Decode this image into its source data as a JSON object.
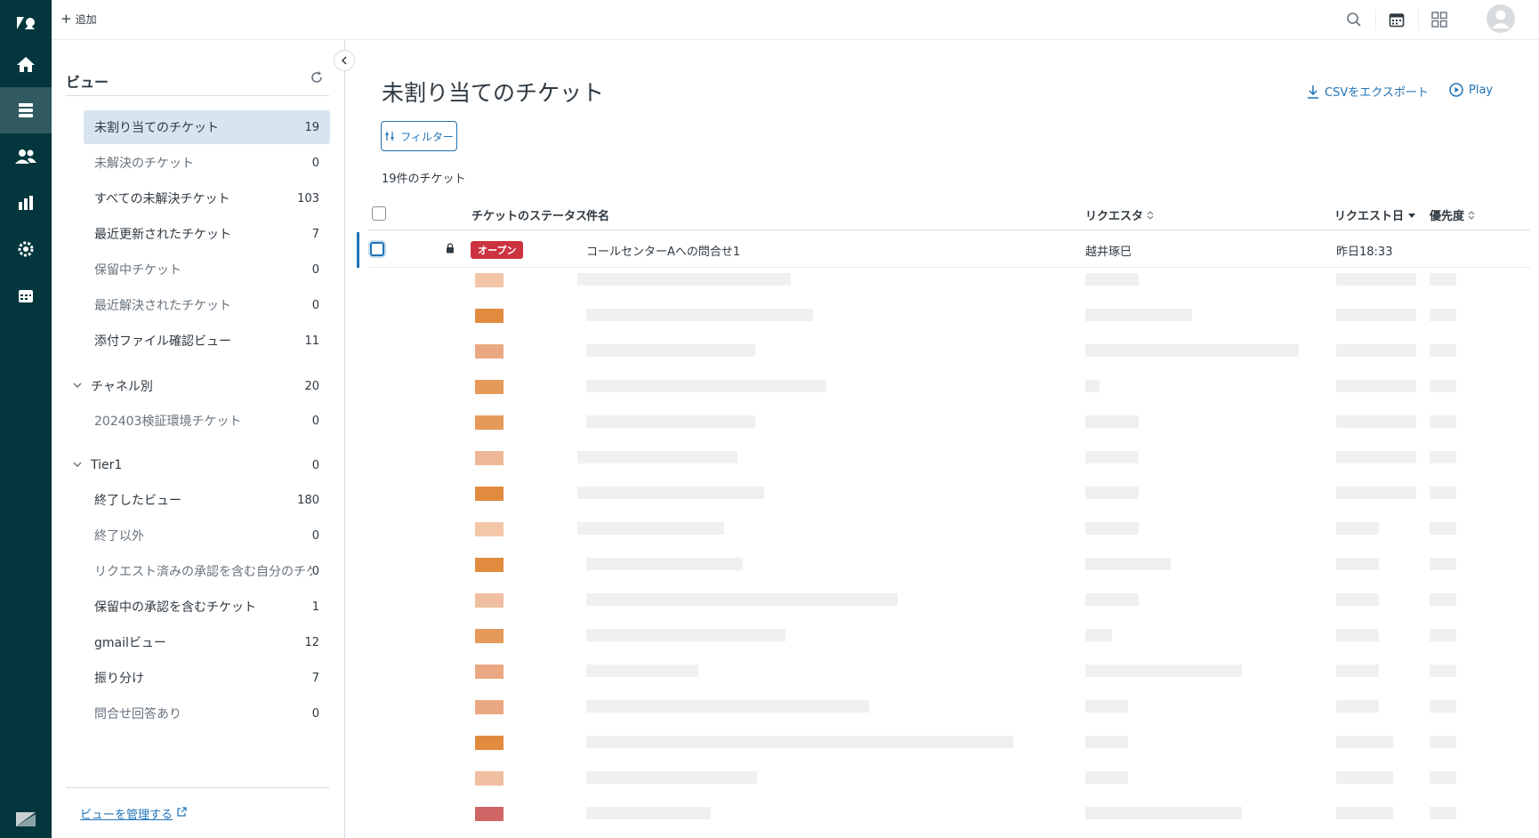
{
  "topbar": {
    "add_label": "追加",
    "icons": [
      "search-icon",
      "calendar-icon",
      "apps-grid-icon",
      "user-avatar-icon"
    ]
  },
  "rail": {
    "items": [
      "home-icon",
      "views-icon",
      "customers-icon",
      "reports-icon",
      "settings-icon",
      "calendar-icon"
    ],
    "active": "views-icon"
  },
  "views": {
    "title": "ビュー",
    "items": [
      {
        "label": "未割り当てのチケット",
        "count": "19"
      },
      {
        "label": "未解決のチケット",
        "count": "0"
      },
      {
        "label": "すべての未解決チケット",
        "count": "103"
      },
      {
        "label": "最近更新されたチケット",
        "count": "7"
      },
      {
        "label": "保留中チケット",
        "count": "0"
      },
      {
        "label": "最近解決されたチケット",
        "count": "0"
      },
      {
        "label": "添付ファイル確認ビュー",
        "count": "11"
      }
    ],
    "group1": {
      "label": "チャネル別",
      "count": "20"
    },
    "group1_items": [
      {
        "label": "202403検証環境チケット",
        "count": "0"
      }
    ],
    "group2": {
      "label": "Tier1",
      "count": "0"
    },
    "group2_items": [
      {
        "label": "終了したビュー",
        "count": "180"
      },
      {
        "label": "終了以外",
        "count": "0"
      },
      {
        "label": "リクエスト済みの承認を含む自分のチケ...",
        "count": "0"
      },
      {
        "label": "保留中の承認を含むチケット",
        "count": "1"
      },
      {
        "label": "gmailビュー",
        "count": "12"
      },
      {
        "label": "振り分け",
        "count": "7"
      },
      {
        "label": "問合せ回答あり",
        "count": "0"
      }
    ],
    "manage_link": "ビューを管理する"
  },
  "main": {
    "title": "未割り当てのチケット",
    "csv_label": "CSVをエクスポート",
    "play_label": "Play",
    "filter_label": "フィルター",
    "ticket_count": "19件のチケット",
    "columns": {
      "status": "チケットのステータス",
      "subject": "件名",
      "requester": "リクエスタ",
      "requested": "リクエスト日",
      "priority": "優先度"
    },
    "first_row": {
      "status": "オープン",
      "subject": "コールセンターAへの問合せ1",
      "requester": "越井琢巳",
      "requested": "昨日18:33"
    }
  },
  "colors": {
    "rail": "#03363d",
    "accent": "#1f73b7",
    "open_badge": "#cc3340",
    "selected_view": "#d8e4f0"
  }
}
